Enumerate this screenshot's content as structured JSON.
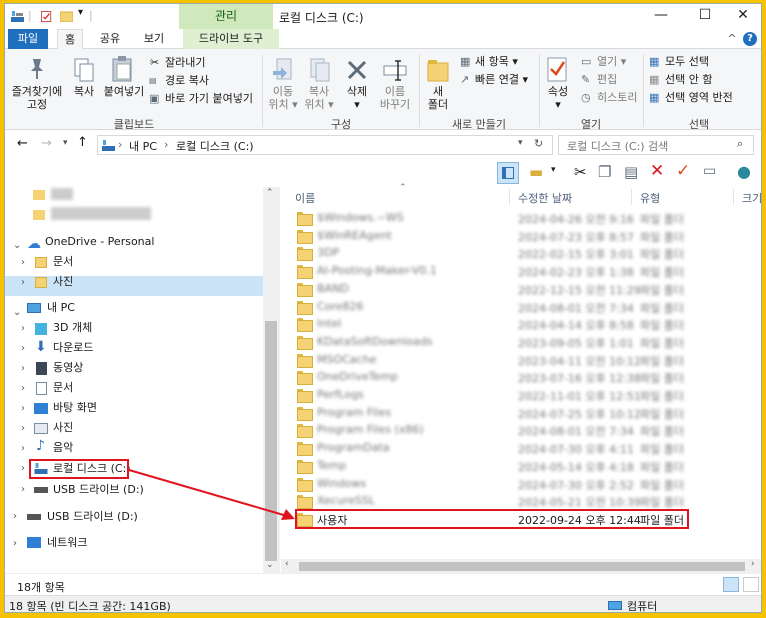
{
  "titlebar": {
    "manage_tab": "관리",
    "title": "로컬 디스크 (C:)",
    "minimize": "—",
    "maximize": "☐",
    "close": "✕"
  },
  "tabs": {
    "file": "파일",
    "home": "홈",
    "share": "공유",
    "view": "보기",
    "drive_tools": "드라이브 도구",
    "expand": "^",
    "help": "?"
  },
  "ribbon": {
    "pin": "즐겨찾기에\n고정",
    "copy": "복사",
    "paste": "붙여넣기",
    "cut": "잘라내기",
    "copy_path": "경로 복사",
    "paste_shortcut": "바로 가기 붙여넣기",
    "clipboard_group": "클립보드",
    "move_to": "이동\n위치 ▾",
    "copy_to": "복사\n위치 ▾",
    "delete": "삭제\n▾",
    "rename": "이름\n바꾸기",
    "organize_group": "구성",
    "new_folder": "새\n폴더",
    "new_item": "새 항목 ▾",
    "easy_access": "빠른 연결 ▾",
    "new_group": "새로 만들기",
    "properties": "속성\n▾",
    "open": "열기 ▾",
    "edit": "편집",
    "history": "히스토리",
    "open_group": "열기",
    "select_all": "모두 선택",
    "select_none": "선택 안 함",
    "invert": "선택 영역 반전",
    "select_group": "선택"
  },
  "address": {
    "path_root": "내 PC",
    "path_sep": "›",
    "path_current": "로컬 디스크 (C:)",
    "search_placeholder": "로컬 디스크 (C:) 검색"
  },
  "nav": {
    "onedrive": "OneDrive - Personal",
    "documents": "문서",
    "pictures": "사진",
    "this_pc": "내 PC",
    "objects3d": "3D 개체",
    "downloads": "다운로드",
    "videos": "동영상",
    "documents2": "문서",
    "desktop": "바탕 화면",
    "pictures2": "사진",
    "music": "음악",
    "local_disk": "로컬 디스크 (C:)",
    "usb_inner": "USB 드라이브 (D:)",
    "usb": "USB 드라이브 (D:)",
    "network": "네트워크"
  },
  "columns": {
    "name": "이름",
    "modified": "수정한 날짜",
    "type": "유형",
    "size": "크기"
  },
  "files": [
    {
      "name": "$Windows.~WS",
      "date": "2024-04-26 오전 9:16",
      "type": "파일 폴더",
      "blurred": true
    },
    {
      "name": "$WinREAgent",
      "date": "2024-07-23 오후 8:57",
      "type": "파일 폴더",
      "blurred": true
    },
    {
      "name": "3DP",
      "date": "2022-02-15 오후 3:01",
      "type": "파일 폴더",
      "blurred": true
    },
    {
      "name": "AI-Posting-Maker-V0.1",
      "date": "2024-02-23 오후 1:38",
      "type": "파일 폴더",
      "blurred": true
    },
    {
      "name": "BAND",
      "date": "2022-12-15 오전 11:29",
      "type": "파일 폴더",
      "blurred": true
    },
    {
      "name": "Core826",
      "date": "2024-08-01 오전 7:34",
      "type": "파일 폴더",
      "blurred": true
    },
    {
      "name": "Intel",
      "date": "2024-04-14 오후 8:58",
      "type": "파일 폴더",
      "blurred": true
    },
    {
      "name": "KDataSoftDownloads",
      "date": "2023-09-05 오후 1:01",
      "type": "파일 폴더",
      "blurred": true
    },
    {
      "name": "MSOCache",
      "date": "2023-04-11 오전 10:12",
      "type": "파일 폴더",
      "blurred": true
    },
    {
      "name": "OneDriveTemp",
      "date": "2023-07-16 오후 12:38",
      "type": "파일 폴더",
      "blurred": true
    },
    {
      "name": "PerfLogs",
      "date": "2022-11-01 오후 12:51",
      "type": "파일 폴더",
      "blurred": true
    },
    {
      "name": "Program Files",
      "date": "2024-07-25 오후 10:12",
      "type": "파일 폴더",
      "blurred": true
    },
    {
      "name": "Program Files (x86)",
      "date": "2024-08-01 오전 7:34",
      "type": "파일 폴더",
      "blurred": true
    },
    {
      "name": "ProgramData",
      "date": "2024-07-30 오후 4:11",
      "type": "파일 폴더",
      "blurred": true
    },
    {
      "name": "Temp",
      "date": "2024-05-14 오후 4:18",
      "type": "파일 폴더",
      "blurred": true
    },
    {
      "name": "Windows",
      "date": "2024-07-30 오후 2:52",
      "type": "파일 폴더",
      "blurred": true
    },
    {
      "name": "XecureSSL",
      "date": "2024-05-21 오전 10:39",
      "type": "파일 폴더",
      "blurred": true
    },
    {
      "name": "사용자",
      "date": "2022-09-24 오후 12:44",
      "type": "파일 폴더",
      "blurred": false
    }
  ],
  "status": {
    "item_count": "18개 항목",
    "bottom_left": "18 항목 (빈 디스크 공간: 141GB)",
    "bottom_right": "컴퓨터"
  },
  "colors": {
    "highlight": "#e0141e",
    "selection": "#cce4f7",
    "file_tab": "#1f6fbf",
    "frame": "#f6c200"
  }
}
